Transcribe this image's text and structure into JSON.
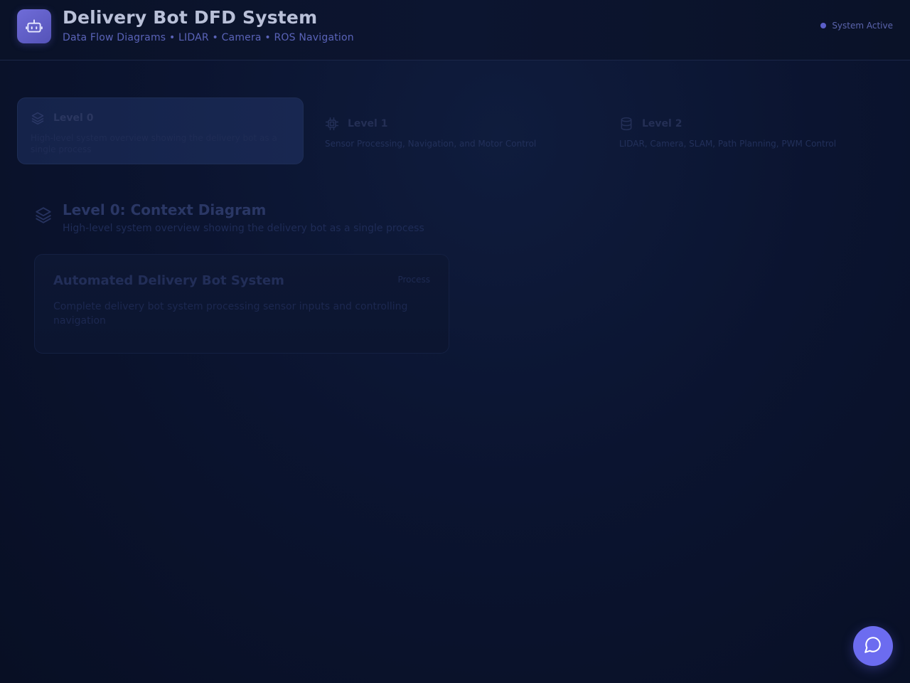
{
  "header": {
    "title": "Delivery Bot DFD System",
    "subtitle": "Data Flow Diagrams • LIDAR • Camera • ROS Navigation",
    "status": "System Active",
    "logo_icon": "robot-icon"
  },
  "levels": [
    {
      "name": "Level 0",
      "description": "High-level system overview showing the delivery bot as a single process",
      "icon": "layers-icon",
      "active": true
    },
    {
      "name": "Level 1",
      "description": "Sensor Processing, Navigation, and Motor Control",
      "icon": "cpu-icon",
      "active": false
    },
    {
      "name": "Level 2",
      "description": "LIDAR, Camera, SLAM, Path Planning, PWM Control",
      "icon": "database-icon",
      "active": false
    }
  ],
  "section": {
    "title": "Level 0: Context Diagram",
    "subtitle": "High-level system overview showing the delivery bot as a single process",
    "icon": "layers-icon"
  },
  "process": {
    "title": "Automated Delivery Bot System",
    "badge": "Process",
    "description": "Complete delivery bot system processing sensor inputs and controlling navigation"
  },
  "chat": {
    "icon": "chat-bubble-icon"
  },
  "colors": {
    "accent": "#6c6cf0",
    "logo": "#6f6cd8",
    "background": "#0b1430"
  }
}
